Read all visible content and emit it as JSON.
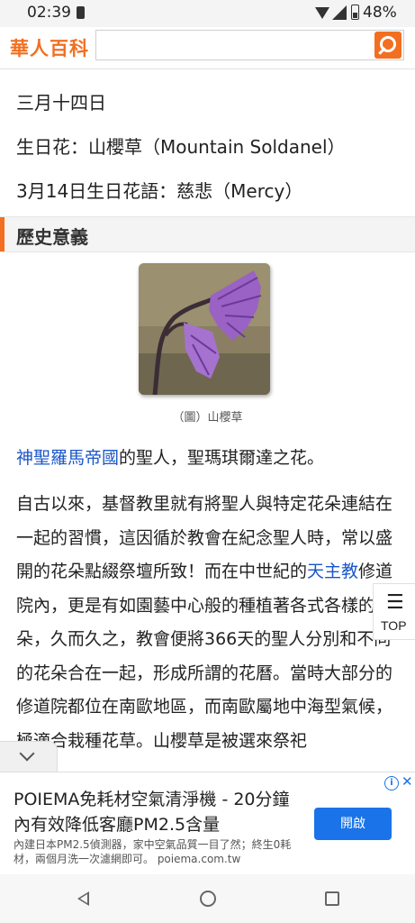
{
  "status_bar": {
    "time": "02:39",
    "battery": "48%"
  },
  "header": {
    "logo": "華人百科",
    "search_placeholder": ""
  },
  "content": {
    "date_line": "三月十四日",
    "flower_line": "生日花：山櫻草（Mountain Soldanel）",
    "language_line": "3月14日生日花語：慈悲（Mercy）",
    "section_title": "歷史意義",
    "image_caption": "（圖）山櫻草",
    "para1": {
      "link": "神聖羅馬帝國",
      "text": "的聖人，聖瑪琪爾達之花。"
    },
    "para2": {
      "part1": "自古以來，基督教里就有將聖人與特定花朵連結在一起的習慣，這因循於教會在紀念聖人時，常以盛開的花朵點綴祭壇所致！而在中世紀的",
      "link": "天主教",
      "part2": "修道院內，更是有如園藝中心般的種植著各式各樣的花朵，久而久之，教會便將366天的聖人分別和不同的花朵合在一起，形成所謂的花曆。當時大部分的修道院都位在南歐地區，而南歐屬地中海型氣候，極適合栽種花草。山櫻草是被選來祭祀"
    }
  },
  "float_widget": {
    "icon": "☰",
    "label": "TOP"
  },
  "ad": {
    "title": "POIEMA免耗材空氣清淨機 - 20分鐘內有效降低客廳PM2.5含量",
    "description": "內建日本PM2.5偵測器，家中空氣品質一目了然；終生0耗材，兩個月洗一次濾網即可。 poiema.com.tw",
    "button": "開啟"
  }
}
